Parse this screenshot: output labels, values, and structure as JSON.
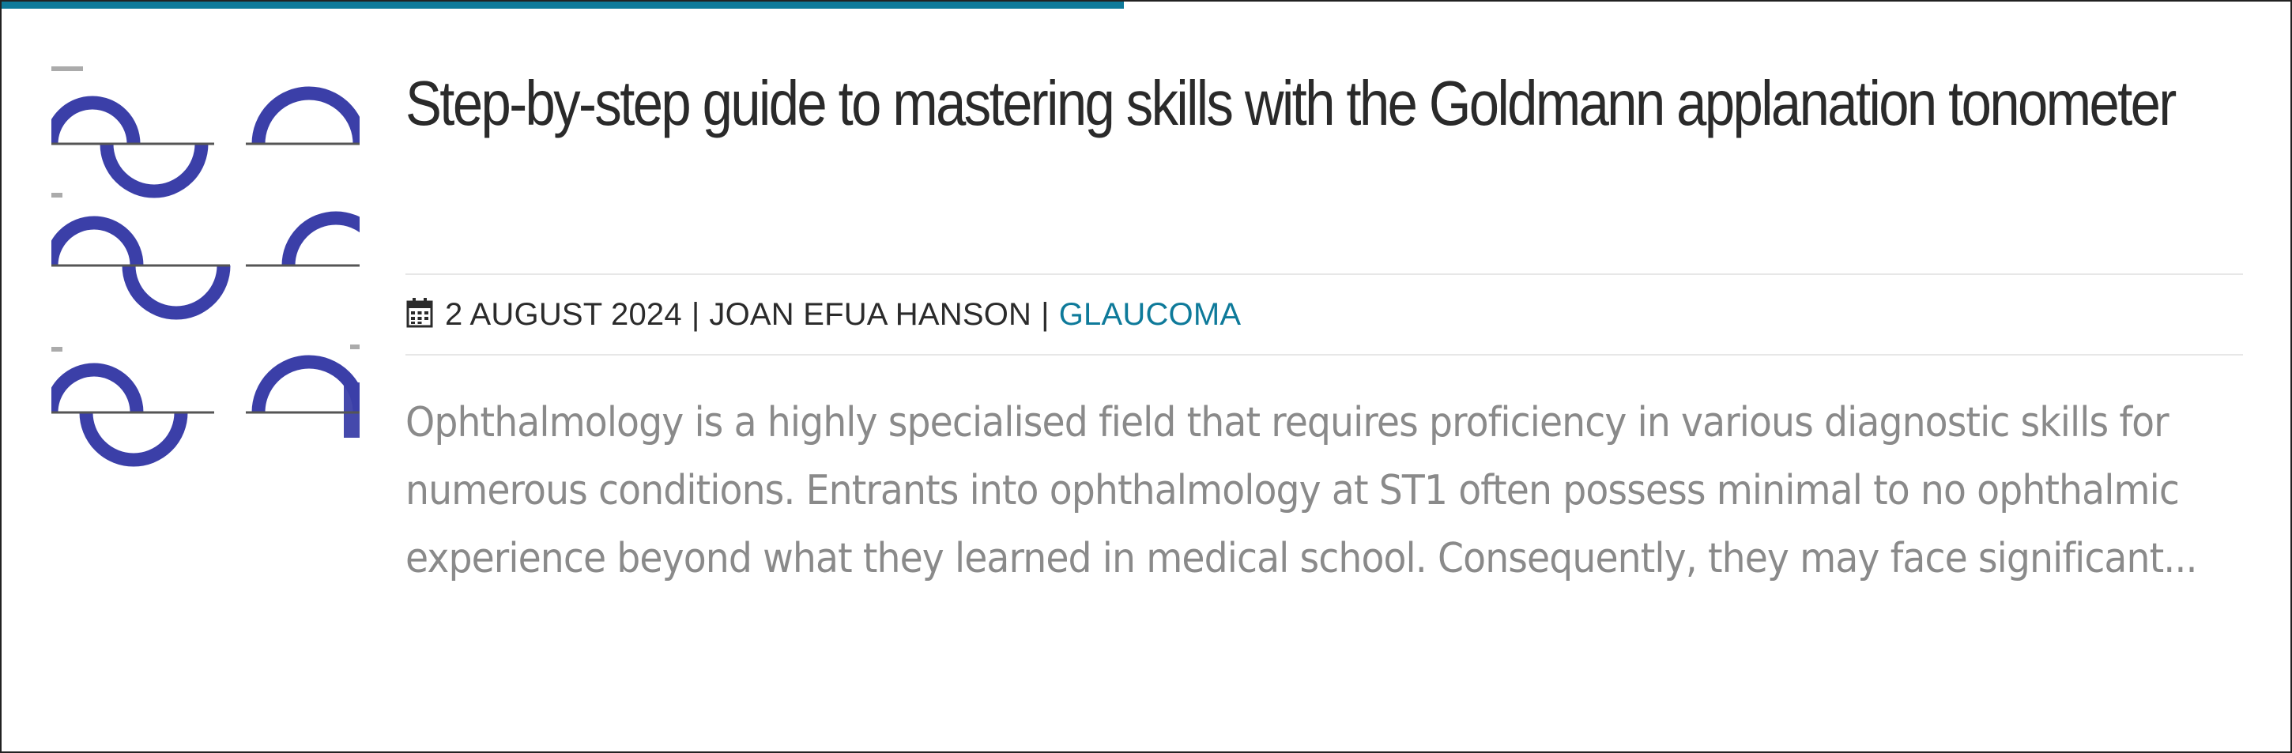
{
  "colors": {
    "accent": "#0e7a9a",
    "title": "#2a2a2a",
    "meta": "#2b2b2b",
    "excerpt": "#8a8a8a",
    "thumbnail_ring": "#3b3fa8",
    "thumbnail_line": "#555555"
  },
  "thumbnail": {
    "icon": "goldmann-applanation-mires-image"
  },
  "article": {
    "title": "Step-by-step guide to mastering skills with the Goldmann applanation tonometer",
    "meta": {
      "icon": "calendar-icon",
      "date": "2 AUGUST 2024",
      "separator": "|",
      "author": "JOAN EFUA HANSON",
      "category": "GLAUCOMA"
    },
    "excerpt": "Ophthalmology is a highly specialised field that requires proficiency in various diagnostic skills for numerous conditions. Entrants into ophthalmology at ST1 often possess minimal to no ophthalmic experience beyond what they learned in medical school. Consequently, they may face significant..."
  }
}
